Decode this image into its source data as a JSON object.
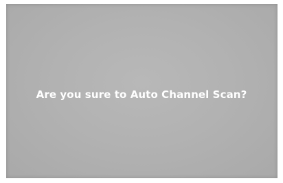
{
  "dialog": {
    "message": "Are you sure to Auto Channel Scan?"
  },
  "colors": {
    "screen_background": "#b2b2b2",
    "frame_background": "#ffffff",
    "message_text": "#ffffff"
  }
}
